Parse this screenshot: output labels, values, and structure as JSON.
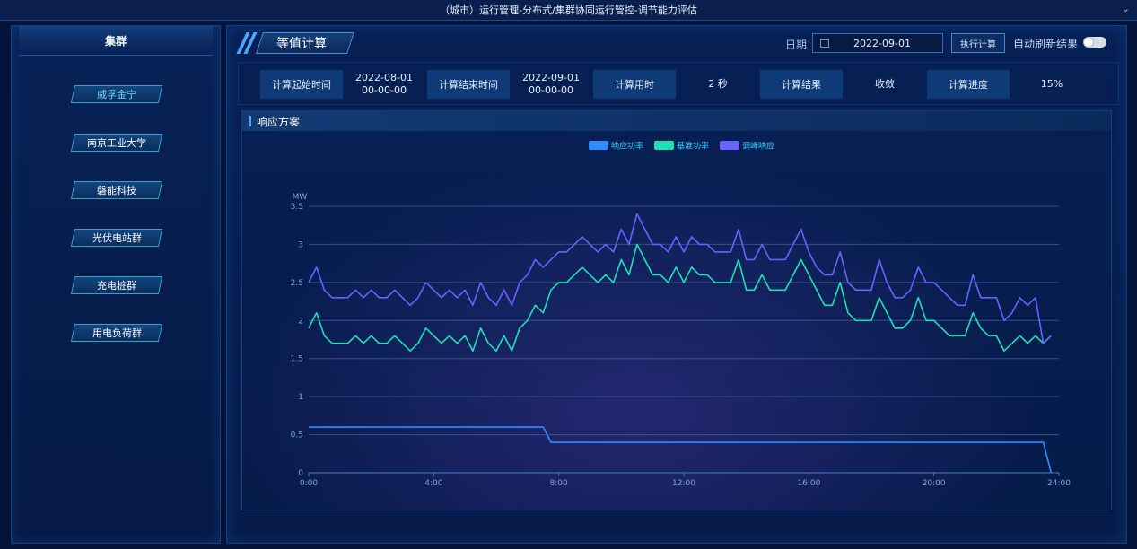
{
  "window": {
    "title": "（城市）运行管理-分布式/集群协同运行管控-调节能力评估"
  },
  "sidebar": {
    "title": "集群",
    "items": [
      {
        "label": "威孚金宁",
        "active": true
      },
      {
        "label": "南京工业大学",
        "active": false
      },
      {
        "label": "磐能科技",
        "active": false
      },
      {
        "label": "光伏电站群",
        "active": false
      },
      {
        "label": "充电桩群",
        "active": false
      },
      {
        "label": "用电负荷群",
        "active": false
      }
    ]
  },
  "main": {
    "section_title": "等值计算",
    "date_label": "日期",
    "date_value": "2022-09-01",
    "exec_button": "执行计算",
    "auto_refresh_label": "自动刷新结果",
    "auto_refresh_on": false,
    "info": {
      "start_label": "计算起始时间",
      "start_date": "2022-08-01",
      "start_time": "00-00-00",
      "end_label": "计算结束时间",
      "end_date": "2022-09-01",
      "end_time": "00-00-00",
      "duration_label": "计算用时",
      "duration_value": "2 秒",
      "result_label": "计算结果",
      "result_value": "收敛",
      "progress_label": "计算进度",
      "progress_value": "15%"
    },
    "chart_title": "响应方案"
  },
  "colors": {
    "series_response": "#2e8cff",
    "series_base": "#1fe0b4",
    "series_peak": "#6a62ff"
  },
  "chart_data": {
    "type": "line",
    "title": "",
    "ylabel": "MW",
    "ylim": [
      0,
      3.5
    ],
    "yticks": [
      "0",
      "0.5",
      "1",
      "1.5",
      "2",
      "2.5",
      "3",
      "3.5"
    ],
    "x_range": [
      0,
      24
    ],
    "xticks": [
      "0:00",
      "4:00",
      "8:00",
      "12:00",
      "16:00",
      "20:00",
      "24:00"
    ],
    "legend": [
      "响应功率",
      "基准功率",
      "调峰响应"
    ],
    "series": [
      {
        "name": "响应功率",
        "x": [
          0,
          7.5,
          7.75,
          23.5,
          23.75
        ],
        "y": [
          0.6,
          0.6,
          0.4,
          0.4,
          0.0
        ]
      },
      {
        "name": "基准功率",
        "x": [
          0,
          0.25,
          0.5,
          0.75,
          1,
          1.25,
          1.5,
          1.75,
          2,
          2.25,
          2.5,
          2.75,
          3,
          3.25,
          3.5,
          3.75,
          4,
          4.25,
          4.5,
          4.75,
          5,
          5.25,
          5.5,
          5.75,
          6,
          6.25,
          6.5,
          6.75,
          7,
          7.25,
          7.5,
          7.75,
          8,
          8.25,
          8.5,
          8.75,
          9,
          9.25,
          9.5,
          9.75,
          10,
          10.25,
          10.5,
          10.75,
          11,
          11.25,
          11.5,
          11.75,
          12,
          12.25,
          12.5,
          12.75,
          13,
          13.25,
          13.5,
          13.75,
          14,
          14.25,
          14.5,
          14.75,
          15,
          15.25,
          15.5,
          15.75,
          16,
          16.25,
          16.5,
          16.75,
          17,
          17.25,
          17.5,
          17.75,
          18,
          18.25,
          18.5,
          18.75,
          19,
          19.25,
          19.5,
          19.75,
          20,
          20.25,
          20.5,
          20.75,
          21,
          21.25,
          21.5,
          21.75,
          22,
          22.25,
          22.5,
          22.75,
          23,
          23.25,
          23.5,
          23.75
        ],
        "y": [
          1.9,
          2.1,
          1.8,
          1.7,
          1.7,
          1.7,
          1.8,
          1.7,
          1.8,
          1.7,
          1.7,
          1.8,
          1.7,
          1.6,
          1.7,
          1.9,
          1.8,
          1.7,
          1.8,
          1.7,
          1.8,
          1.6,
          1.9,
          1.7,
          1.6,
          1.8,
          1.6,
          1.9,
          2.0,
          2.2,
          2.1,
          2.4,
          2.5,
          2.5,
          2.6,
          2.7,
          2.6,
          2.5,
          2.6,
          2.5,
          2.8,
          2.6,
          3.0,
          2.8,
          2.6,
          2.6,
          2.5,
          2.7,
          2.5,
          2.7,
          2.6,
          2.6,
          2.5,
          2.5,
          2.5,
          2.8,
          2.4,
          2.4,
          2.6,
          2.4,
          2.4,
          2.4,
          2.6,
          2.8,
          2.6,
          2.4,
          2.2,
          2.2,
          2.5,
          2.1,
          2.0,
          2.0,
          2.0,
          2.3,
          2.1,
          1.9,
          1.9,
          2.0,
          2.3,
          2.0,
          2.0,
          1.9,
          1.8,
          1.8,
          1.8,
          2.1,
          1.9,
          1.8,
          1.8,
          1.6,
          1.7,
          1.8,
          1.7,
          1.8,
          1.7,
          1.8
        ]
      },
      {
        "name": "调峰响应",
        "x": [
          0,
          0.25,
          0.5,
          0.75,
          1,
          1.25,
          1.5,
          1.75,
          2,
          2.25,
          2.5,
          2.75,
          3,
          3.25,
          3.5,
          3.75,
          4,
          4.25,
          4.5,
          4.75,
          5,
          5.25,
          5.5,
          5.75,
          6,
          6.25,
          6.5,
          6.75,
          7,
          7.25,
          7.5,
          7.75,
          8,
          8.25,
          8.5,
          8.75,
          9,
          9.25,
          9.5,
          9.75,
          10,
          10.25,
          10.5,
          10.75,
          11,
          11.25,
          11.5,
          11.75,
          12,
          12.25,
          12.5,
          12.75,
          13,
          13.25,
          13.5,
          13.75,
          14,
          14.25,
          14.5,
          14.75,
          15,
          15.25,
          15.5,
          15.75,
          16,
          16.25,
          16.5,
          16.75,
          17,
          17.25,
          17.5,
          17.75,
          18,
          18.25,
          18.5,
          18.75,
          19,
          19.25,
          19.5,
          19.75,
          20,
          20.25,
          20.5,
          20.75,
          21,
          21.25,
          21.5,
          21.75,
          22,
          22.25,
          22.5,
          22.75,
          23,
          23.25,
          23.5,
          23.75
        ],
        "y": [
          2.5,
          2.7,
          2.4,
          2.3,
          2.3,
          2.3,
          2.4,
          2.3,
          2.4,
          2.3,
          2.3,
          2.4,
          2.3,
          2.2,
          2.3,
          2.5,
          2.4,
          2.3,
          2.4,
          2.3,
          2.4,
          2.2,
          2.5,
          2.3,
          2.2,
          2.4,
          2.2,
          2.5,
          2.6,
          2.8,
          2.7,
          2.8,
          2.9,
          2.9,
          3.0,
          3.1,
          3.0,
          2.9,
          3.0,
          2.9,
          3.2,
          3.0,
          3.4,
          3.2,
          3.0,
          3.0,
          2.9,
          3.1,
          2.9,
          3.1,
          3.0,
          3.0,
          2.9,
          2.9,
          2.9,
          3.2,
          2.8,
          2.8,
          3.0,
          2.8,
          2.8,
          2.8,
          3.0,
          3.2,
          2.9,
          2.7,
          2.6,
          2.6,
          2.9,
          2.5,
          2.4,
          2.4,
          2.4,
          2.8,
          2.5,
          2.3,
          2.3,
          2.4,
          2.7,
          2.5,
          2.5,
          2.4,
          2.3,
          2.2,
          2.2,
          2.6,
          2.3,
          2.3,
          2.3,
          2.0,
          2.1,
          2.3,
          2.2,
          2.3,
          1.7,
          1.8
        ]
      }
    ]
  }
}
